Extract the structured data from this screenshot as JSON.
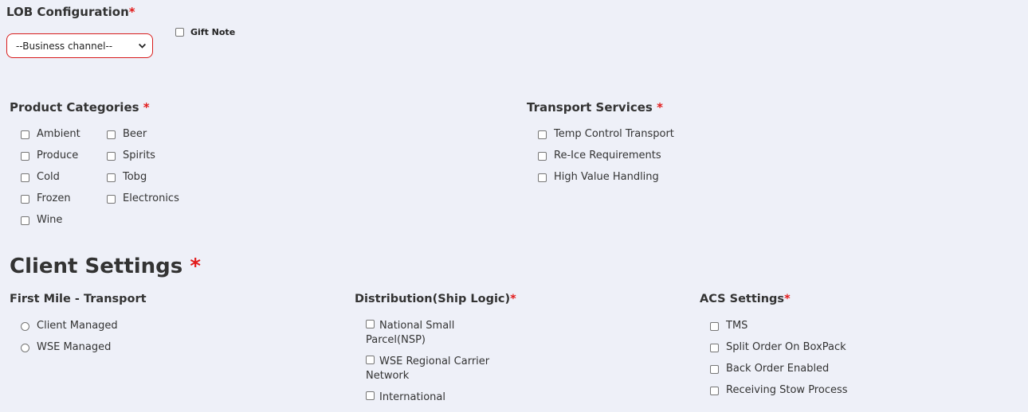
{
  "lob": {
    "title": "LOB Configuration",
    "required_mark": "*",
    "select_value": "--Business channel--",
    "gift_note_label": "Gift Note"
  },
  "product_categories": {
    "title": "Product Categories",
    "required_mark": "*",
    "col1": [
      "Ambient",
      "Produce",
      "Cold",
      "Frozen",
      "Wine"
    ],
    "col2": [
      "Beer",
      "Spirits",
      "Tobg",
      "Electronics"
    ]
  },
  "transport_services": {
    "title": "Transport Services",
    "required_mark": "*",
    "items": [
      "Temp Control Transport",
      "Re-Ice Requirements",
      "High Value Handling"
    ]
  },
  "client_settings": {
    "title": "Client Settings",
    "required_mark": "*"
  },
  "first_mile": {
    "title": "First Mile - Transport",
    "items": [
      "Client Managed",
      "WSE Managed"
    ]
  },
  "distribution": {
    "title": "Distribution(Ship Logic)",
    "required_mark": "*",
    "items": [
      "National Small Parcel(NSP)",
      "WSE Regional Carrier Network",
      "International"
    ]
  },
  "acs": {
    "title": "ACS Settings",
    "required_mark": "*",
    "items": [
      "TMS",
      "Split Order On BoxPack",
      "Back Order Enabled",
      "Receiving Stow Process"
    ]
  },
  "colors": {
    "background": "#eef0f8",
    "required": "#e21a1a",
    "select_border": "#d81b1b"
  }
}
